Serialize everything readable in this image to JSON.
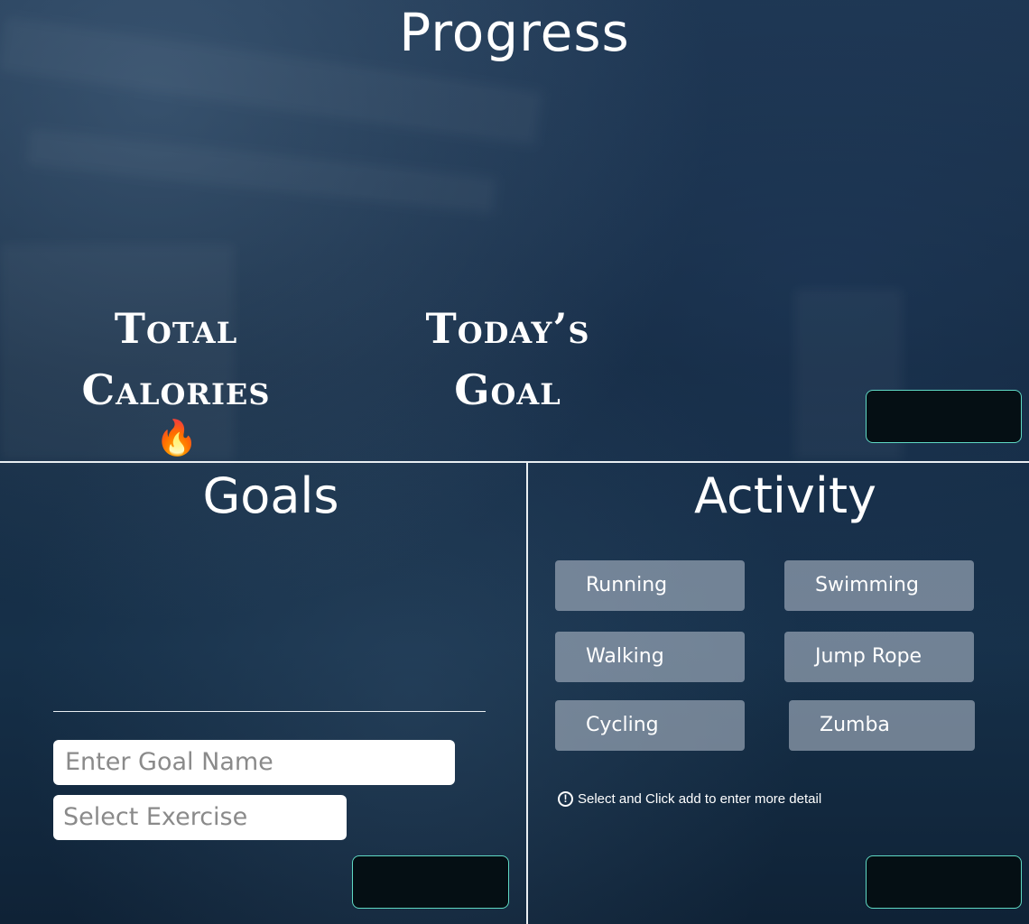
{
  "header": {
    "title": "Progress"
  },
  "stats": {
    "total_calories_line1": "Total",
    "total_calories_line2": "Calories",
    "total_calories_icon": "fire-icon",
    "todays_goal_line1": "Today’s",
    "todays_goal_line2": "Goal"
  },
  "goals": {
    "title": "Goals",
    "goal_name_placeholder": "Enter Goal Name",
    "exercise_placeholder": "Select Exercise"
  },
  "activity": {
    "title": "Activity",
    "options": [
      "Running",
      "Swimming",
      "Walking",
      "Jump Rope",
      "Cycling",
      "Zumba"
    ],
    "hint": "Select and Click add to enter more detail",
    "hint_icon": "info-icon"
  },
  "colors": {
    "button_border": "#5fd9c4",
    "button_fill": "#050f14",
    "activity_button": "#aab4c3"
  }
}
